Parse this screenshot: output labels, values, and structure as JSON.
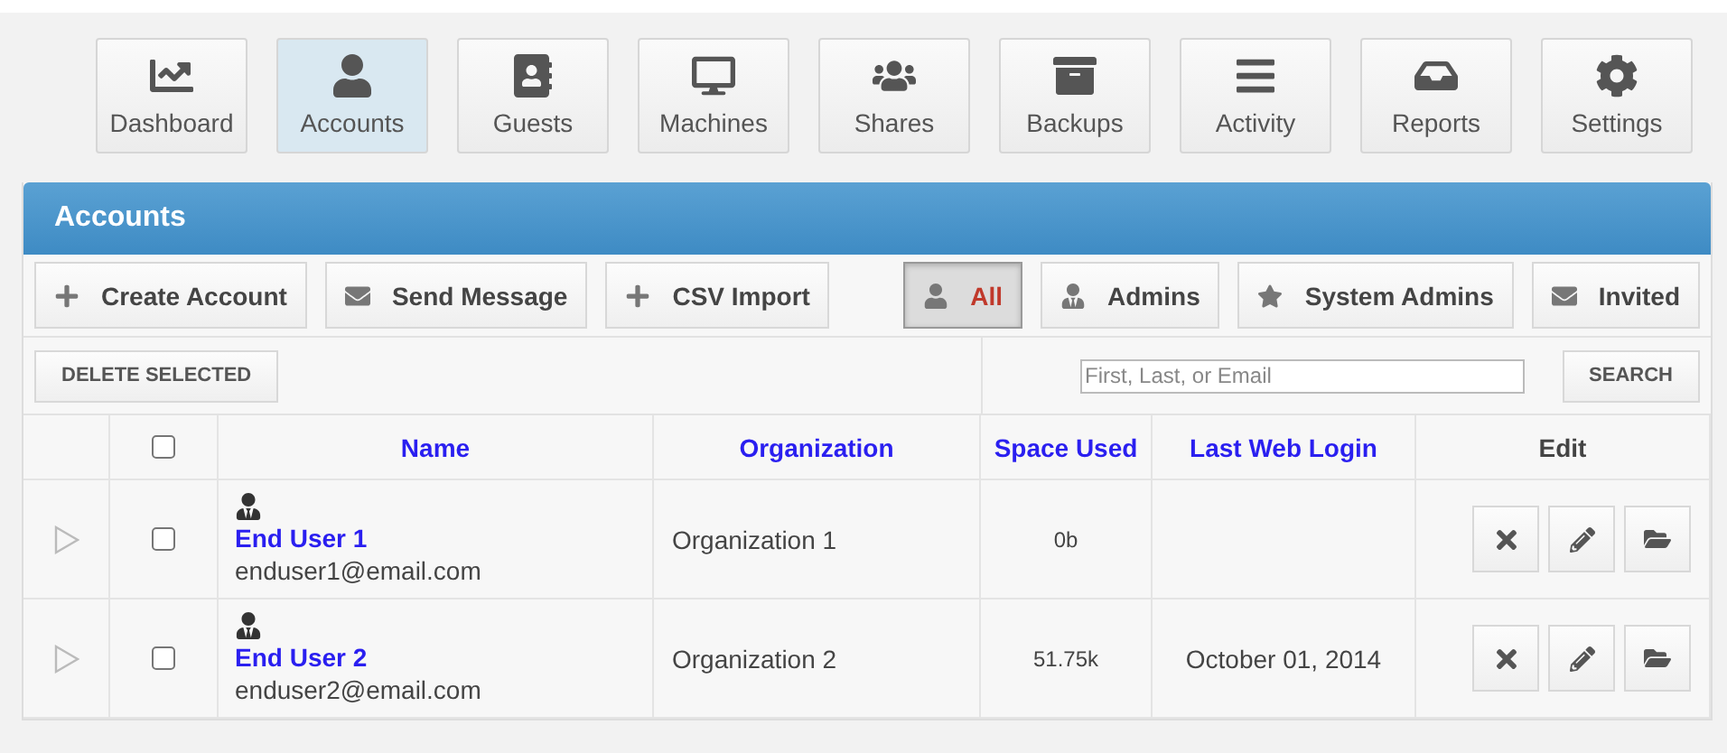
{
  "nav": [
    {
      "label": "Dashboard",
      "selected": false
    },
    {
      "label": "Accounts",
      "selected": true
    },
    {
      "label": "Guests",
      "selected": false
    },
    {
      "label": "Machines",
      "selected": false
    },
    {
      "label": "Shares",
      "selected": false
    },
    {
      "label": "Backups",
      "selected": false
    },
    {
      "label": "Activity",
      "selected": false
    },
    {
      "label": "Reports",
      "selected": false
    },
    {
      "label": "Settings",
      "selected": false
    }
  ],
  "panel": {
    "title": "Accounts",
    "actions": [
      "Create Account",
      "Send Message",
      "CSV Import"
    ],
    "filters": [
      {
        "label": "All",
        "selected": true
      },
      {
        "label": "Admins",
        "selected": false
      },
      {
        "label": "System Admins",
        "selected": false
      },
      {
        "label": "Invited",
        "selected": false
      }
    ],
    "delete_button": "DELETE SELECTED",
    "search": {
      "placeholder": "First, Last, or Email",
      "button": "SEARCH"
    },
    "table": {
      "select_all_checked": false,
      "columns": [
        "Name",
        "Organization",
        "Space Used",
        "Last Web Login",
        "Edit"
      ],
      "rows": [
        {
          "checked": false,
          "name": "End User 1",
          "email": "enduser1@email.com",
          "organization": "Organization 1",
          "space_used": "0b"
        },
        {
          "checked": false,
          "name": "End User 2",
          "email": "enduser2@email.com",
          "organization": "Organization 2",
          "space_used": "51.75k",
          "last_web_login": "October 01, 2014"
        }
      ]
    }
  }
}
